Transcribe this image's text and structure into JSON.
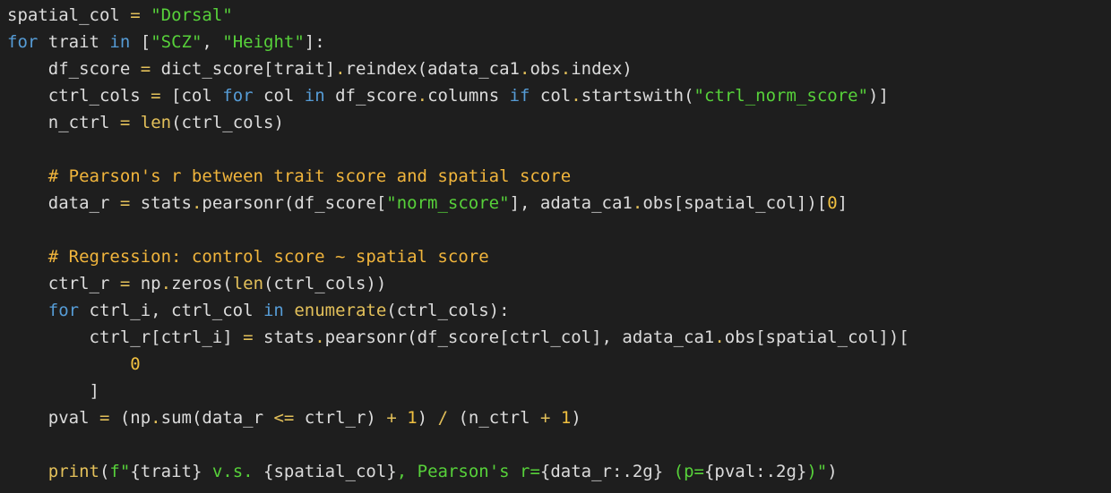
{
  "theme": {
    "background": "#1e1e1e",
    "colors": {
      "txt": "#dcdcdc",
      "kw": "#569cd6",
      "str": "#57d13a",
      "op": "#e3c05a",
      "num": "#f0c040",
      "fn": "#e3c05a",
      "cm": "#f1b53c"
    }
  },
  "code": {
    "lines": [
      [
        [
          "txt",
          "spatial_col "
        ],
        [
          "op",
          "="
        ],
        [
          "txt",
          " "
        ],
        [
          "str",
          "\"Dorsal\""
        ]
      ],
      [
        [
          "kw",
          "for"
        ],
        [
          "txt",
          " trait "
        ],
        [
          "kw",
          "in"
        ],
        [
          "txt",
          " ["
        ],
        [
          "str",
          "\"SCZ\""
        ],
        [
          "txt",
          ", "
        ],
        [
          "str",
          "\"Height\""
        ],
        [
          "txt",
          "]:"
        ]
      ],
      [
        [
          "txt",
          "    df_score "
        ],
        [
          "op",
          "="
        ],
        [
          "txt",
          " dict_score[trait]"
        ],
        [
          "op",
          "."
        ],
        [
          "txt",
          "reindex(adata_ca1"
        ],
        [
          "op",
          "."
        ],
        [
          "txt",
          "obs"
        ],
        [
          "op",
          "."
        ],
        [
          "txt",
          "index)"
        ]
      ],
      [
        [
          "txt",
          "    ctrl_cols "
        ],
        [
          "op",
          "="
        ],
        [
          "txt",
          " [col "
        ],
        [
          "kw",
          "for"
        ],
        [
          "txt",
          " col "
        ],
        [
          "kw",
          "in"
        ],
        [
          "txt",
          " df_score"
        ],
        [
          "op",
          "."
        ],
        [
          "txt",
          "columns "
        ],
        [
          "kw",
          "if"
        ],
        [
          "txt",
          " col"
        ],
        [
          "op",
          "."
        ],
        [
          "txt",
          "startswith("
        ],
        [
          "str",
          "\"ctrl_norm_score\""
        ],
        [
          "txt",
          ")]"
        ]
      ],
      [
        [
          "txt",
          "    n_ctrl "
        ],
        [
          "op",
          "="
        ],
        [
          "txt",
          " "
        ],
        [
          "fn",
          "len"
        ],
        [
          "txt",
          "(ctrl_cols)"
        ]
      ],
      [],
      [
        [
          "cm",
          "    # Pearson's r between trait score and spatial score"
        ]
      ],
      [
        [
          "txt",
          "    data_r "
        ],
        [
          "op",
          "="
        ],
        [
          "txt",
          " stats"
        ],
        [
          "op",
          "."
        ],
        [
          "txt",
          "pearsonr(df_score["
        ],
        [
          "str",
          "\"norm_score\""
        ],
        [
          "txt",
          "], adata_ca1"
        ],
        [
          "op",
          "."
        ],
        [
          "txt",
          "obs[spatial_col])["
        ],
        [
          "num",
          "0"
        ],
        [
          "txt",
          "]"
        ]
      ],
      [],
      [
        [
          "cm",
          "    # Regression: control score ~ spatial score"
        ]
      ],
      [
        [
          "txt",
          "    ctrl_r "
        ],
        [
          "op",
          "="
        ],
        [
          "txt",
          " np"
        ],
        [
          "op",
          "."
        ],
        [
          "txt",
          "zeros("
        ],
        [
          "fn",
          "len"
        ],
        [
          "txt",
          "(ctrl_cols))"
        ]
      ],
      [
        [
          "kw",
          "    for"
        ],
        [
          "txt",
          " ctrl_i, ctrl_col "
        ],
        [
          "kw",
          "in"
        ],
        [
          "txt",
          " "
        ],
        [
          "fn",
          "enumerate"
        ],
        [
          "txt",
          "(ctrl_cols):"
        ]
      ],
      [
        [
          "txt",
          "        ctrl_r[ctrl_i] "
        ],
        [
          "op",
          "="
        ],
        [
          "txt",
          " stats"
        ],
        [
          "op",
          "."
        ],
        [
          "txt",
          "pearsonr(df_score[ctrl_col], adata_ca1"
        ],
        [
          "op",
          "."
        ],
        [
          "txt",
          "obs[spatial_col])["
        ]
      ],
      [
        [
          "txt",
          "            "
        ],
        [
          "num",
          "0"
        ]
      ],
      [
        [
          "txt",
          "        ]"
        ]
      ],
      [
        [
          "txt",
          "    pval "
        ],
        [
          "op",
          "="
        ],
        [
          "txt",
          " (np"
        ],
        [
          "op",
          "."
        ],
        [
          "txt",
          "sum(data_r "
        ],
        [
          "op",
          "<="
        ],
        [
          "txt",
          " ctrl_r) "
        ],
        [
          "op",
          "+"
        ],
        [
          "txt",
          " "
        ],
        [
          "num",
          "1"
        ],
        [
          "txt",
          ") "
        ],
        [
          "op",
          "/"
        ],
        [
          "txt",
          " (n_ctrl "
        ],
        [
          "op",
          "+"
        ],
        [
          "txt",
          " "
        ],
        [
          "num",
          "1"
        ],
        [
          "txt",
          ")"
        ]
      ],
      [],
      [
        [
          "txt",
          "    "
        ],
        [
          "fn",
          "print"
        ],
        [
          "txt",
          "("
        ],
        [
          "str",
          "f\""
        ],
        [
          "txt",
          "{trait}"
        ],
        [
          "str",
          " v.s. "
        ],
        [
          "txt",
          "{spatial_col}"
        ],
        [
          "str",
          ", Pearson's r="
        ],
        [
          "txt",
          "{data_r:.2g}"
        ],
        [
          "str",
          " (p="
        ],
        [
          "txt",
          "{pval:.2g}"
        ],
        [
          "str",
          ")\""
        ],
        [
          "txt",
          ")"
        ]
      ]
    ]
  }
}
